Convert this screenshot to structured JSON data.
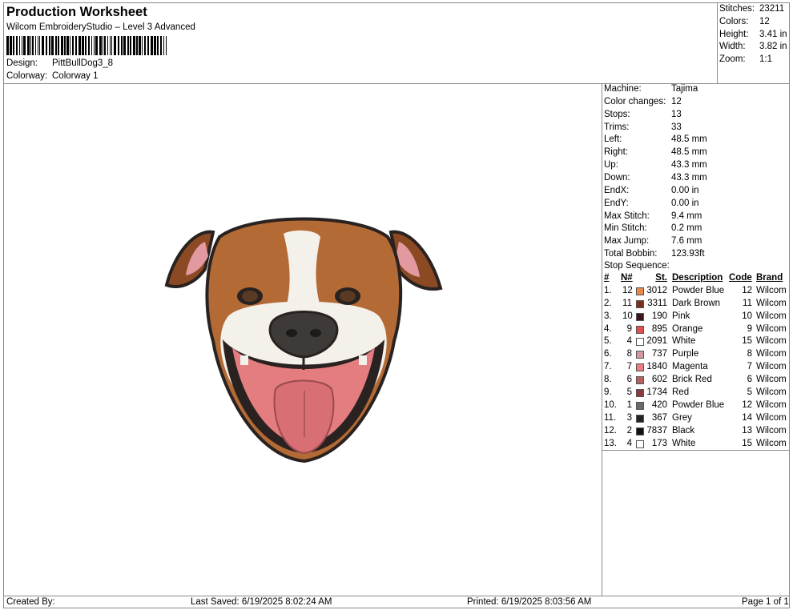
{
  "header": {
    "title": "Production Worksheet",
    "subtitle": "Wilcom EmbroideryStudio – Level 3 Advanced",
    "design_label": "Design:",
    "design_value": "PittBullDog3_8",
    "colorway_label": "Colorway:",
    "colorway_value": "Colorway 1"
  },
  "stats": [
    {
      "label": "Stitches:",
      "value": "23211"
    },
    {
      "label": "Colors:",
      "value": "12"
    },
    {
      "label": "Height:",
      "value": "3.41 in"
    },
    {
      "label": "Width:",
      "value": "3.82 in"
    },
    {
      "label": "Zoom:",
      "value": "1:1"
    }
  ],
  "machine_info": [
    {
      "label": "Machine:",
      "value": "Tajima"
    },
    {
      "label": "Color changes:",
      "value": "12"
    },
    {
      "label": "Stops:",
      "value": "13"
    },
    {
      "label": "Trims:",
      "value": "33"
    },
    {
      "label": "Left:",
      "value": "48.5 mm"
    },
    {
      "label": "Right:",
      "value": "48.5 mm"
    },
    {
      "label": "Up:",
      "value": "43.3 mm"
    },
    {
      "label": "Down:",
      "value": "43.3 mm"
    },
    {
      "label": "EndX:",
      "value": "0.00 in"
    },
    {
      "label": "EndY:",
      "value": "0.00 in"
    },
    {
      "label": "Max Stitch:",
      "value": "9.4 mm"
    },
    {
      "label": "Min Stitch:",
      "value": "0.2 mm"
    },
    {
      "label": "Max Jump:",
      "value": "7.6 mm"
    },
    {
      "label": "Total Bobbin:",
      "value": "123.93ft"
    }
  ],
  "stop_sequence": {
    "label": "Stop Sequence:",
    "headers": {
      "idx": "#",
      "n": "N#",
      "st": "St.",
      "desc": "Description",
      "code": "Code",
      "brand": "Brand"
    },
    "rows": [
      {
        "idx": "1.",
        "n": "12",
        "color": "#e8894a",
        "st": "3012",
        "desc": "Powder Blue",
        "code": "12",
        "brand": "Wilcom"
      },
      {
        "idx": "2.",
        "n": "11",
        "color": "#7a2e1c",
        "st": "3311",
        "desc": "Dark Brown",
        "code": "11",
        "brand": "Wilcom"
      },
      {
        "idx": "3.",
        "n": "10",
        "color": "#3a1618",
        "st": "190",
        "desc": "Pink",
        "code": "10",
        "brand": "Wilcom"
      },
      {
        "idx": "4.",
        "n": "9",
        "color": "#e2504e",
        "st": "895",
        "desc": "Orange",
        "code": "9",
        "brand": "Wilcom"
      },
      {
        "idx": "5.",
        "n": "4",
        "color": "#ffffff",
        "st": "2091",
        "desc": "White",
        "code": "15",
        "brand": "Wilcom"
      },
      {
        "idx": "6.",
        "n": "8",
        "color": "#d29aa0",
        "st": "737",
        "desc": "Purple",
        "code": "8",
        "brand": "Wilcom"
      },
      {
        "idx": "7.",
        "n": "7",
        "color": "#ee7a82",
        "st": "1840",
        "desc": "Magenta",
        "code": "7",
        "brand": "Wilcom"
      },
      {
        "idx": "8.",
        "n": "6",
        "color": "#b8605e",
        "st": "602",
        "desc": "Brick Red",
        "code": "6",
        "brand": "Wilcom"
      },
      {
        "idx": "9.",
        "n": "5",
        "color": "#8c3a40",
        "st": "1734",
        "desc": "Red",
        "code": "5",
        "brand": "Wilcom"
      },
      {
        "idx": "10.",
        "n": "1",
        "color": "#6a6a6a",
        "st": "420",
        "desc": "Powder Blue",
        "code": "12",
        "brand": "Wilcom"
      },
      {
        "idx": "11.",
        "n": "3",
        "color": "#222222",
        "st": "367",
        "desc": "Grey",
        "code": "14",
        "brand": "Wilcom"
      },
      {
        "idx": "12.",
        "n": "2",
        "color": "#111111",
        "st": "7837",
        "desc": "Black",
        "code": "13",
        "brand": "Wilcom"
      },
      {
        "idx": "13.",
        "n": "4",
        "color": "#ffffff",
        "st": "173",
        "desc": "White",
        "code": "15",
        "brand": "Wilcom"
      }
    ]
  },
  "footer": {
    "created_by": "Created By:",
    "last_saved": "Last Saved: 6/19/2025 8:02:24 AM",
    "printed": "Printed: 6/19/2025 8:03:56 AM",
    "page": "Page 1 of 1"
  },
  "artwork": {
    "icon": "pitbull-dog-embroidery-icon",
    "colors": {
      "brown": "#8b4a24",
      "tan": "#c07a40",
      "white": "#f4f0ea",
      "pink": "#e47d80",
      "tongue": "#d86f74",
      "outline": "#2a2220",
      "nose": "#3d3a38"
    }
  }
}
